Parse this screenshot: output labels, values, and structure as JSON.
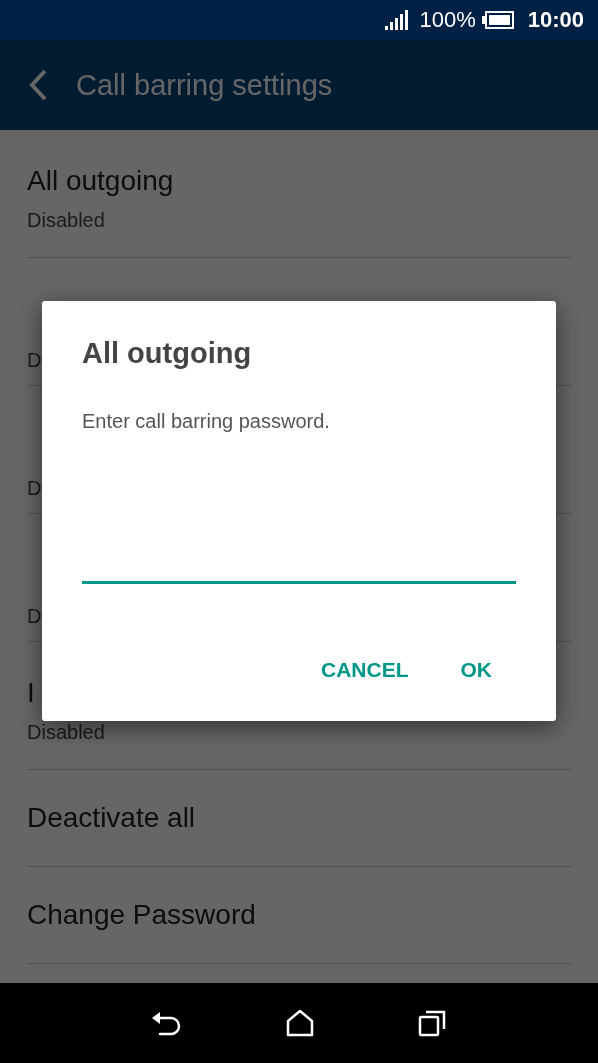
{
  "status_bar": {
    "battery": "100%",
    "time": "10:00"
  },
  "app_bar": {
    "title": "Call barring settings"
  },
  "settings": [
    {
      "title": "All outgoing",
      "summary": "Disabled"
    },
    {
      "summary": "D"
    },
    {
      "summary": "D"
    },
    {
      "summary": "D"
    },
    {
      "title": "I",
      "summary": "Disabled"
    },
    {
      "title": "Deactivate all"
    },
    {
      "title": "Change Password"
    }
  ],
  "dialog": {
    "title": "All outgoing",
    "message": "Enter call barring password.",
    "buttons": [
      "CANCEL",
      "OK"
    ]
  }
}
